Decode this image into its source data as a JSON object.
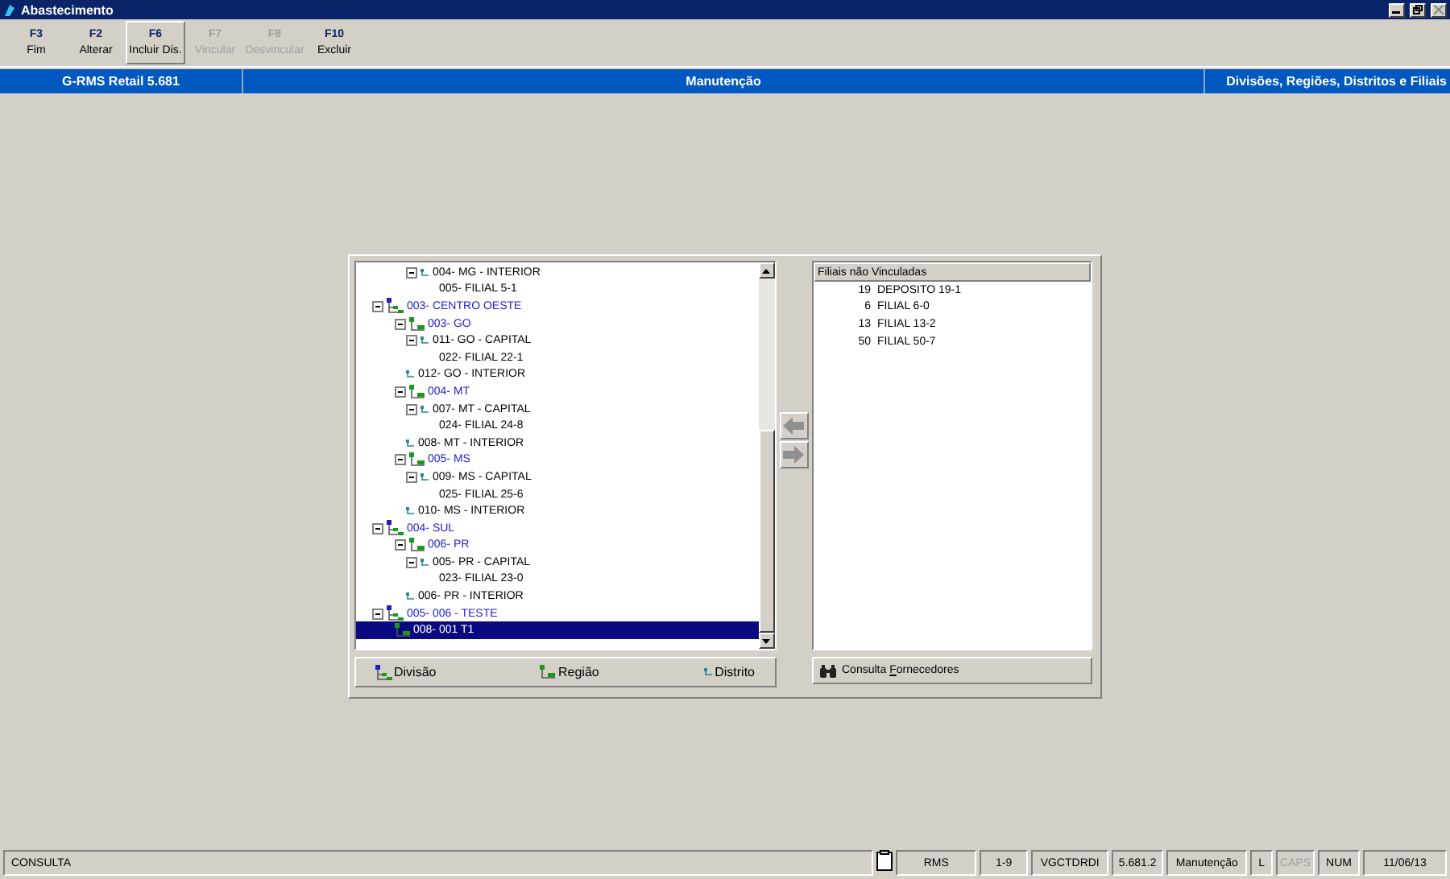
{
  "window": {
    "title": "Abastecimento"
  },
  "toolbar": [
    {
      "key": "F3",
      "label": "Fim",
      "disabled": false,
      "selected": false
    },
    {
      "key": "F2",
      "label": "Alterar",
      "disabled": false,
      "selected": false
    },
    {
      "key": "F6",
      "label": "Incluir Dis.",
      "disabled": false,
      "selected": true
    },
    {
      "key": "F7",
      "label": "Vincular",
      "disabled": true,
      "selected": false
    },
    {
      "key": "F8",
      "label": "Desvincular",
      "disabled": true,
      "selected": false
    },
    {
      "key": "F10",
      "label": "Excluir",
      "disabled": false,
      "selected": false
    }
  ],
  "header": {
    "app": "G-RMS Retail 5.681",
    "mode": "Manutenção",
    "screen": "Divisões, Regiões, Distritos e Filiais"
  },
  "tree": [
    {
      "label": "004- MG - INTERIOR",
      "kind": "district",
      "expanded": true,
      "selected": false,
      "children": [
        {
          "label": "005- FILIAL 5-1",
          "kind": "branch",
          "selected": false
        }
      ]
    },
    {
      "label": "003- CENTRO OESTE",
      "kind": "division",
      "expanded": true,
      "selected": false,
      "children": [
        {
          "label": "003- GO",
          "kind": "region",
          "expanded": true,
          "selected": false,
          "children": [
            {
              "label": "011- GO - CAPITAL",
              "kind": "district",
              "expanded": true,
              "selected": false,
              "children": [
                {
                  "label": "022- FILIAL 22-1",
                  "kind": "branch",
                  "selected": false
                }
              ]
            },
            {
              "label": "012- GO - INTERIOR",
              "kind": "district",
              "selected": false
            }
          ]
        },
        {
          "label": "004- MT",
          "kind": "region",
          "expanded": true,
          "selected": false,
          "children": [
            {
              "label": "007- MT - CAPITAL",
              "kind": "district",
              "expanded": true,
              "selected": false,
              "children": [
                {
                  "label": "024- FILIAL 24-8",
                  "kind": "branch",
                  "selected": false
                }
              ]
            },
            {
              "label": "008- MT - INTERIOR",
              "kind": "district",
              "selected": false
            }
          ]
        },
        {
          "label": "005- MS",
          "kind": "region",
          "expanded": true,
          "selected": false,
          "children": [
            {
              "label": "009- MS - CAPITAL",
              "kind": "district",
              "expanded": true,
              "selected": false,
              "children": [
                {
                  "label": "025- FILIAL 25-6",
                  "kind": "branch",
                  "selected": false
                }
              ]
            },
            {
              "label": "010- MS - INTERIOR",
              "kind": "district",
              "selected": false
            }
          ]
        }
      ]
    },
    {
      "label": "004- SUL",
      "kind": "division",
      "expanded": true,
      "selected": false,
      "children": [
        {
          "label": "006- PR",
          "kind": "region",
          "expanded": true,
          "selected": false,
          "children": [
            {
              "label": "005- PR - CAPITAL",
              "kind": "district",
              "expanded": true,
              "selected": false,
              "children": [
                {
                  "label": "023- FILIAL 23-0",
                  "kind": "branch",
                  "selected": false
                }
              ]
            },
            {
              "label": "006- PR - INTERIOR",
              "kind": "district",
              "selected": false
            }
          ]
        }
      ]
    },
    {
      "label": "005- 006 - TESTE",
      "kind": "division",
      "expanded": true,
      "selected": false,
      "children": [
        {
          "label": "008- 001 T1",
          "kind": "region",
          "selected": true
        }
      ]
    }
  ],
  "tree_buttons": [
    {
      "label": "Divisão",
      "kind": "division"
    },
    {
      "label": "Região",
      "kind": "region"
    },
    {
      "label": "Distrito",
      "kind": "district"
    }
  ],
  "unlinked": {
    "column": "Filiais não Vinculadas",
    "rows": [
      {
        "code": "19",
        "name": "DEPOSITO 19-1"
      },
      {
        "code": "6",
        "name": "FILIAL 6-0"
      },
      {
        "code": "13",
        "name": "FILIAL 13-2"
      },
      {
        "code": "50",
        "name": "FILIAL 50-7"
      }
    ],
    "button": {
      "label": "Consulta ",
      "accel": "F",
      "rest": "ornecedores"
    }
  },
  "status_bar": {
    "message": "CONSULTA",
    "fields": [
      {
        "text": "RMS",
        "disabled": false
      },
      {
        "text": "1-9",
        "disabled": false
      },
      {
        "text": "VGCTDRDI",
        "disabled": false
      },
      {
        "text": "5.681.2",
        "disabled": false
      },
      {
        "text": "Manutenção",
        "disabled": false
      },
      {
        "text": "L",
        "disabled": false
      },
      {
        "text": "CAPS",
        "disabled": true
      },
      {
        "text": "NUM",
        "disabled": false
      },
      {
        "text": "11/06/13",
        "disabled": false
      }
    ]
  }
}
